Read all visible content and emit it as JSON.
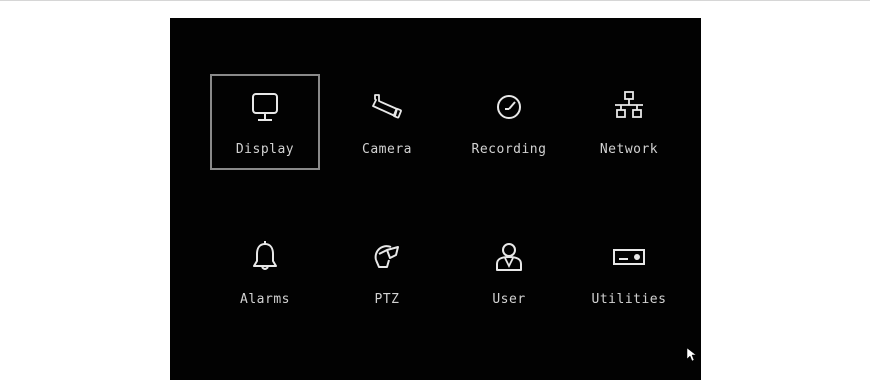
{
  "menu": {
    "items": [
      {
        "label": "Display",
        "icon": "monitor-icon",
        "selected": true
      },
      {
        "label": "Camera",
        "icon": "camera-icon",
        "selected": false
      },
      {
        "label": "Recording",
        "icon": "clock-icon",
        "selected": false
      },
      {
        "label": "Network",
        "icon": "network-icon",
        "selected": false
      },
      {
        "label": "Alarms",
        "icon": "bell-icon",
        "selected": false
      },
      {
        "label": "PTZ",
        "icon": "ptz-camera-icon",
        "selected": false
      },
      {
        "label": "User",
        "icon": "user-icon",
        "selected": false
      },
      {
        "label": "Utilities",
        "icon": "utilities-icon",
        "selected": false
      }
    ]
  },
  "colors": {
    "background": "#020202",
    "text": "#d2d2d2",
    "icon": "#e8e8e8",
    "selection_border": "#8a8a8a",
    "page_background": "#ffffff"
  }
}
